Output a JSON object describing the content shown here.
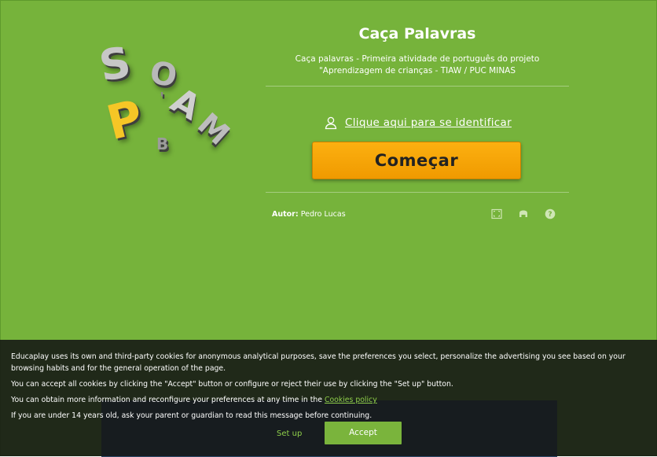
{
  "activity": {
    "title": "Caça Palavras",
    "description": "Caça palavras - Primeira atividade de português do projeto \"Aprendizagem de crianças - TIAW / PUC MINAS",
    "identify_link": "Clique aqui para se identificar",
    "start_button": "Começar",
    "author_label": "Autor:",
    "author_name": "Pedro Lucas"
  },
  "logo_letters": {
    "s": "S",
    "o": "O",
    "p": "P",
    "a": "A",
    "m": "M",
    "b": "B",
    "quote": "'"
  },
  "icons": [
    "fullscreen-icon",
    "print-icon",
    "help-icon",
    "user-icon"
  ],
  "cookie_banner": {
    "line1": "Educaplay uses its own and third-party cookies for anonymous analytical purposes, save the preferences you select, personalize the advertising you see based on your browsing habits and for the general operation of the page.",
    "line2": "You can accept all cookies by clicking the \"Accept\" button or configure or reject their use by clicking the \"Set up\" button.",
    "line3_prefix": "You can obtain more information and reconfigure your preferences at any time in the ",
    "line3_link": "Cookies policy",
    "line4": "If you are under 14 years old, ask your parent or guardian to read this message before continuing.",
    "setup_button": "Set up",
    "accept_button": "Accept"
  },
  "colors": {
    "background_green": "#76b33b",
    "start_button_orange": "#f7a800",
    "cookie_link_green": "#8fcf4a"
  }
}
